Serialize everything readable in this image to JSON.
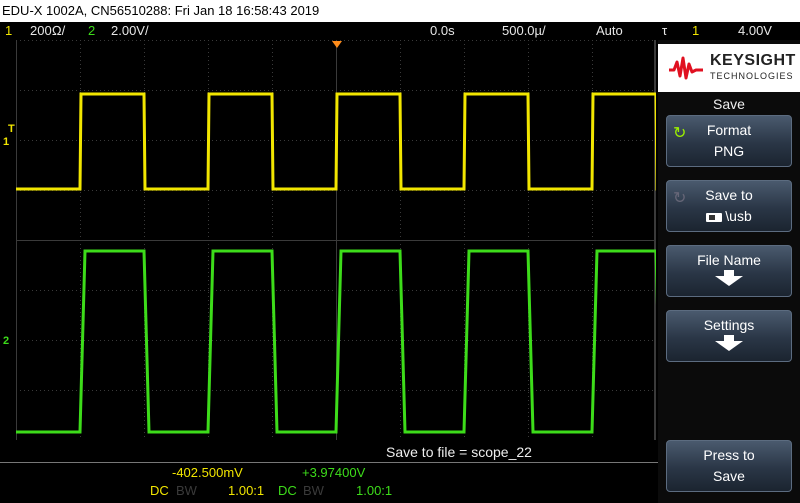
{
  "title": "EDU-X 1002A, CN56510288: Fri Jan 18 16:58:43 2019",
  "status": {
    "ch1_num": "1",
    "ch1_scale": "200Ω/",
    "ch2_num": "2",
    "ch2_scale": "2.00V/",
    "delay": "0.0s",
    "timebase": "500.0µ/",
    "trigger_mode": "Auto",
    "trig_icon": "τ",
    "trig_channel": "1",
    "trig_level": "4.00V"
  },
  "markers": {
    "trig_T": "T",
    "ch1": "1",
    "ch2": "2"
  },
  "waveforms": {
    "ch1_color": "#f2e600",
    "ch2_color": "#3ddc1a",
    "grid_color": "#3a3a3a"
  },
  "bottom": {
    "save_to_file": "Save to file =  scope_22",
    "ch1_measure": "-402.500mV",
    "ch2_measure": "+3.97400V",
    "ch1_coupling": "DC",
    "ch1_bw": "BW",
    "ch1_probe": "1.00:1",
    "ch2_coupling": "DC",
    "ch2_bw": "BW",
    "ch2_probe": "1.00:1"
  },
  "panel": {
    "brand": "KEYSIGHT",
    "brand_sub": "TECHNOLOGIES",
    "menu_title": "Save",
    "format_label": "Format",
    "format_value": "PNG",
    "save_to_label": "Save to",
    "save_to_value": "\\usb",
    "file_name_label": "File Name",
    "settings_label": "Settings",
    "press_label": "Press to",
    "press_value": "Save"
  }
}
